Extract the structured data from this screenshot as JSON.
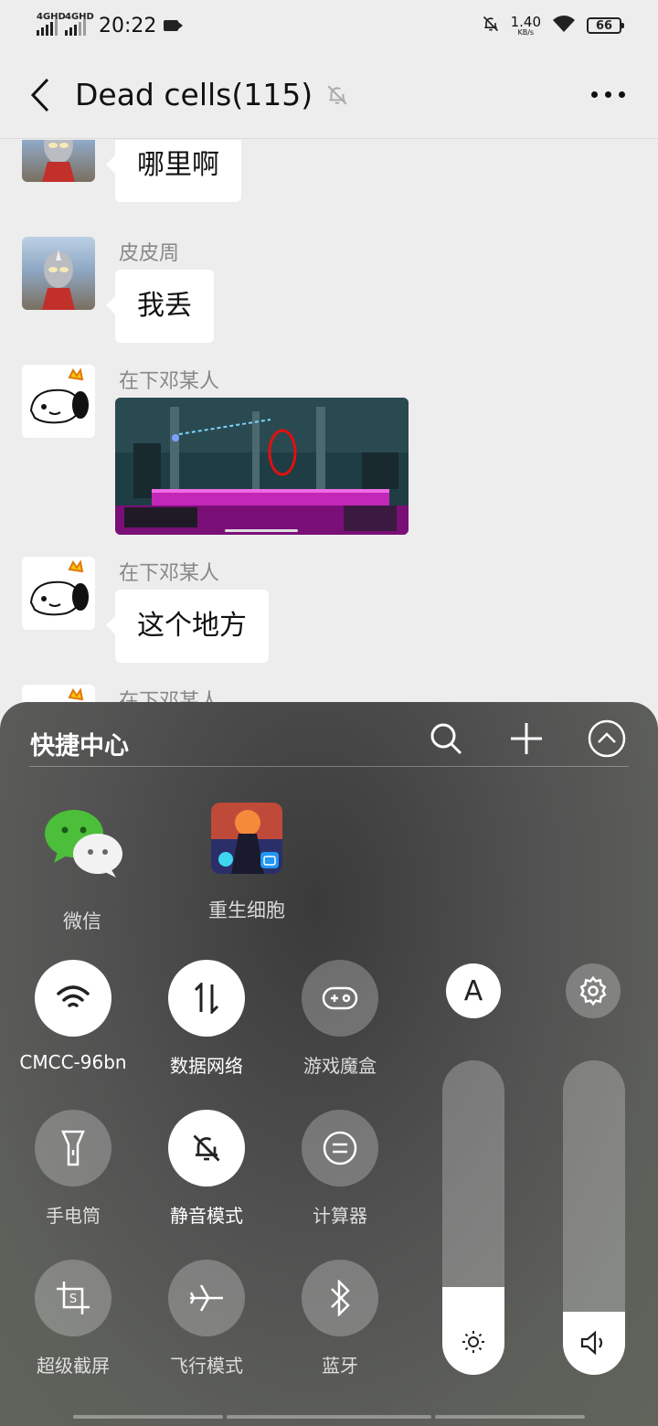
{
  "status_bar": {
    "signal1_label": "4GHD",
    "signal2_label": "4GHD",
    "time": "20:22",
    "net_speed_value": "1.40",
    "net_speed_unit": "KB/s",
    "battery": "66"
  },
  "header": {
    "title": "Dead cells(115)"
  },
  "chat": {
    "messages": [
      {
        "sender": "",
        "text": "哪里啊"
      },
      {
        "sender": "皮皮周",
        "text": "我丢"
      },
      {
        "sender": "在下邓某人",
        "text": ""
      },
      {
        "sender": "在下邓某人",
        "text": "这个地方"
      },
      {
        "sender": "在下邓某人",
        "text": ""
      }
    ]
  },
  "control_center": {
    "title": "快捷中心",
    "apps": [
      {
        "label": "微信",
        "icon": "wechat-icon"
      },
      {
        "label": "重生细胞",
        "icon": "dead-cells-app-icon"
      }
    ],
    "toggles": [
      {
        "label": "CMCC-96bn",
        "icon": "wifi-icon",
        "on": true
      },
      {
        "label": "数据网络",
        "icon": "mobile-data-icon",
        "on": true
      },
      {
        "label": "游戏魔盒",
        "icon": "gamepad-icon",
        "on": false
      },
      {
        "label": "手电筒",
        "icon": "flashlight-icon",
        "on": false
      },
      {
        "label": "静音模式",
        "icon": "mute-bell-icon",
        "on": true
      },
      {
        "label": "计算器",
        "icon": "calculator-icon",
        "on": false
      },
      {
        "label": "超级截屏",
        "icon": "screenshot-icon",
        "on": false
      },
      {
        "label": "飞行模式",
        "icon": "airplane-icon",
        "on": false
      },
      {
        "label": "蓝牙",
        "icon": "bluetooth-icon",
        "on": false
      }
    ],
    "auto_brightness_label": "A",
    "brightness_level": 0.28,
    "volume_level": 0.2
  },
  "colors": {
    "chat_bg": "#ededed",
    "bubble": "#ffffff",
    "toggle_on": "#ffffff"
  }
}
